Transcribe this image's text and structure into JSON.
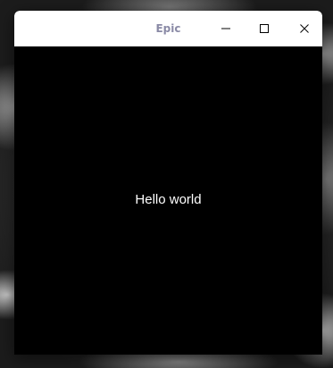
{
  "desktop": {
    "wallpaper": "earth-monochrome"
  },
  "window": {
    "title": "Epic",
    "controls": {
      "minimize_icon": "minimize-icon",
      "maximize_icon": "maximize-icon",
      "close_icon": "close-icon"
    },
    "content": {
      "text": "Hello world",
      "background": "#000000",
      "text_color": "#ffffff"
    },
    "titlebar_color": "#ffffff",
    "title_color": "#8a8aa6"
  }
}
